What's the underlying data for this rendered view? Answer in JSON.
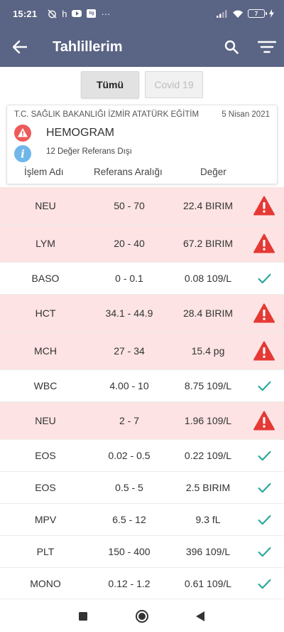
{
  "status_bar": {
    "time": "15:21",
    "h_label": "h",
    "app_badge": "tlg",
    "more": "···",
    "battery": "7"
  },
  "app_bar": {
    "title": "Tahlillerim"
  },
  "tabs": [
    {
      "label": "Tümü",
      "active": true
    },
    {
      "label": "Covid 19",
      "active": false
    }
  ],
  "card": {
    "hospital": "T.C. SAĞLIK BAKANLIĞI İZMİR ATATÜRK EĞİTİM",
    "date": "5 Nisan 2021",
    "test_name": "HEMOGRAM",
    "out_of_range_text": "12 Değer Referans Dışı",
    "headers": {
      "name": "İşlem Adı",
      "range": "Referans Aralığı",
      "value": "Değer"
    }
  },
  "results": [
    {
      "name": "NEU",
      "range": "50 - 70",
      "value": "22.4 BIRIM",
      "status": "warning"
    },
    {
      "name": "LYM",
      "range": "20 - 40",
      "value": "67.2 BIRIM",
      "status": "warning"
    },
    {
      "name": "BASO",
      "range": "0 - 0.1",
      "value": "0.08 109/L",
      "status": "ok"
    },
    {
      "name": "HCT",
      "range": "34.1 - 44.9",
      "value": "28.4 BIRIM",
      "status": "warning"
    },
    {
      "name": "MCH",
      "range": "27 - 34",
      "value": "15.4 pg",
      "status": "warning"
    },
    {
      "name": "WBC",
      "range": "4.00 - 10",
      "value": "8.75 109/L",
      "status": "ok"
    },
    {
      "name": "NEU",
      "range": "2 - 7",
      "value": "1.96 109/L",
      "status": "warning"
    },
    {
      "name": "EOS",
      "range": "0.02 - 0.5",
      "value": "0.22 109/L",
      "status": "ok"
    },
    {
      "name": "EOS",
      "range": "0.5 - 5",
      "value": "2.5 BIRIM",
      "status": "ok"
    },
    {
      "name": "MPV",
      "range": "6.5 - 12",
      "value": "9.3 fL",
      "status": "ok"
    },
    {
      "name": "PLT",
      "range": "150 - 400",
      "value": "396 109/L",
      "status": "ok"
    },
    {
      "name": "MONO",
      "range": "0.12 - 1.2",
      "value": "0.61 109/L",
      "status": "ok"
    }
  ],
  "colors": {
    "header": "#5a6484",
    "abnormal_row": "#fde3e3",
    "warning": "#e53935",
    "check": "#26a69a",
    "info": "#64b5f6"
  }
}
